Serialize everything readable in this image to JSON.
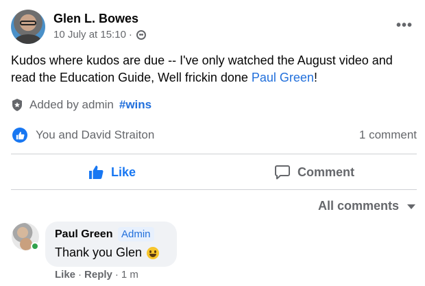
{
  "post": {
    "author": "Glen L. Bowes",
    "timestamp": "10 July at 15:10",
    "separator": "·",
    "audience_icon": "group-icon",
    "body_text": "Kudos where kudos are due -- I've only watched the August video and read the Education Guide, Well frickin done ",
    "mention": "Paul Green",
    "body_end": "!",
    "more_label": "•••"
  },
  "admin_tag": {
    "text": "Added by admin",
    "hashtag": "#wins"
  },
  "reactions": {
    "reactors": "You and David Straiton",
    "comment_count": "1 comment"
  },
  "actions": {
    "like": "Like",
    "comment": "Comment"
  },
  "sort": {
    "label": "All comments"
  },
  "comment": {
    "author": "Paul Green",
    "badge": "Admin",
    "text": "Thank you Glen",
    "like": "Like",
    "dot1": "·",
    "reply": "Reply",
    "dot2": "·",
    "age": "1 m"
  },
  "colors": {
    "accent": "#1877f2",
    "link": "#216fdb",
    "muted": "#65676b",
    "online": "#31a24c"
  }
}
